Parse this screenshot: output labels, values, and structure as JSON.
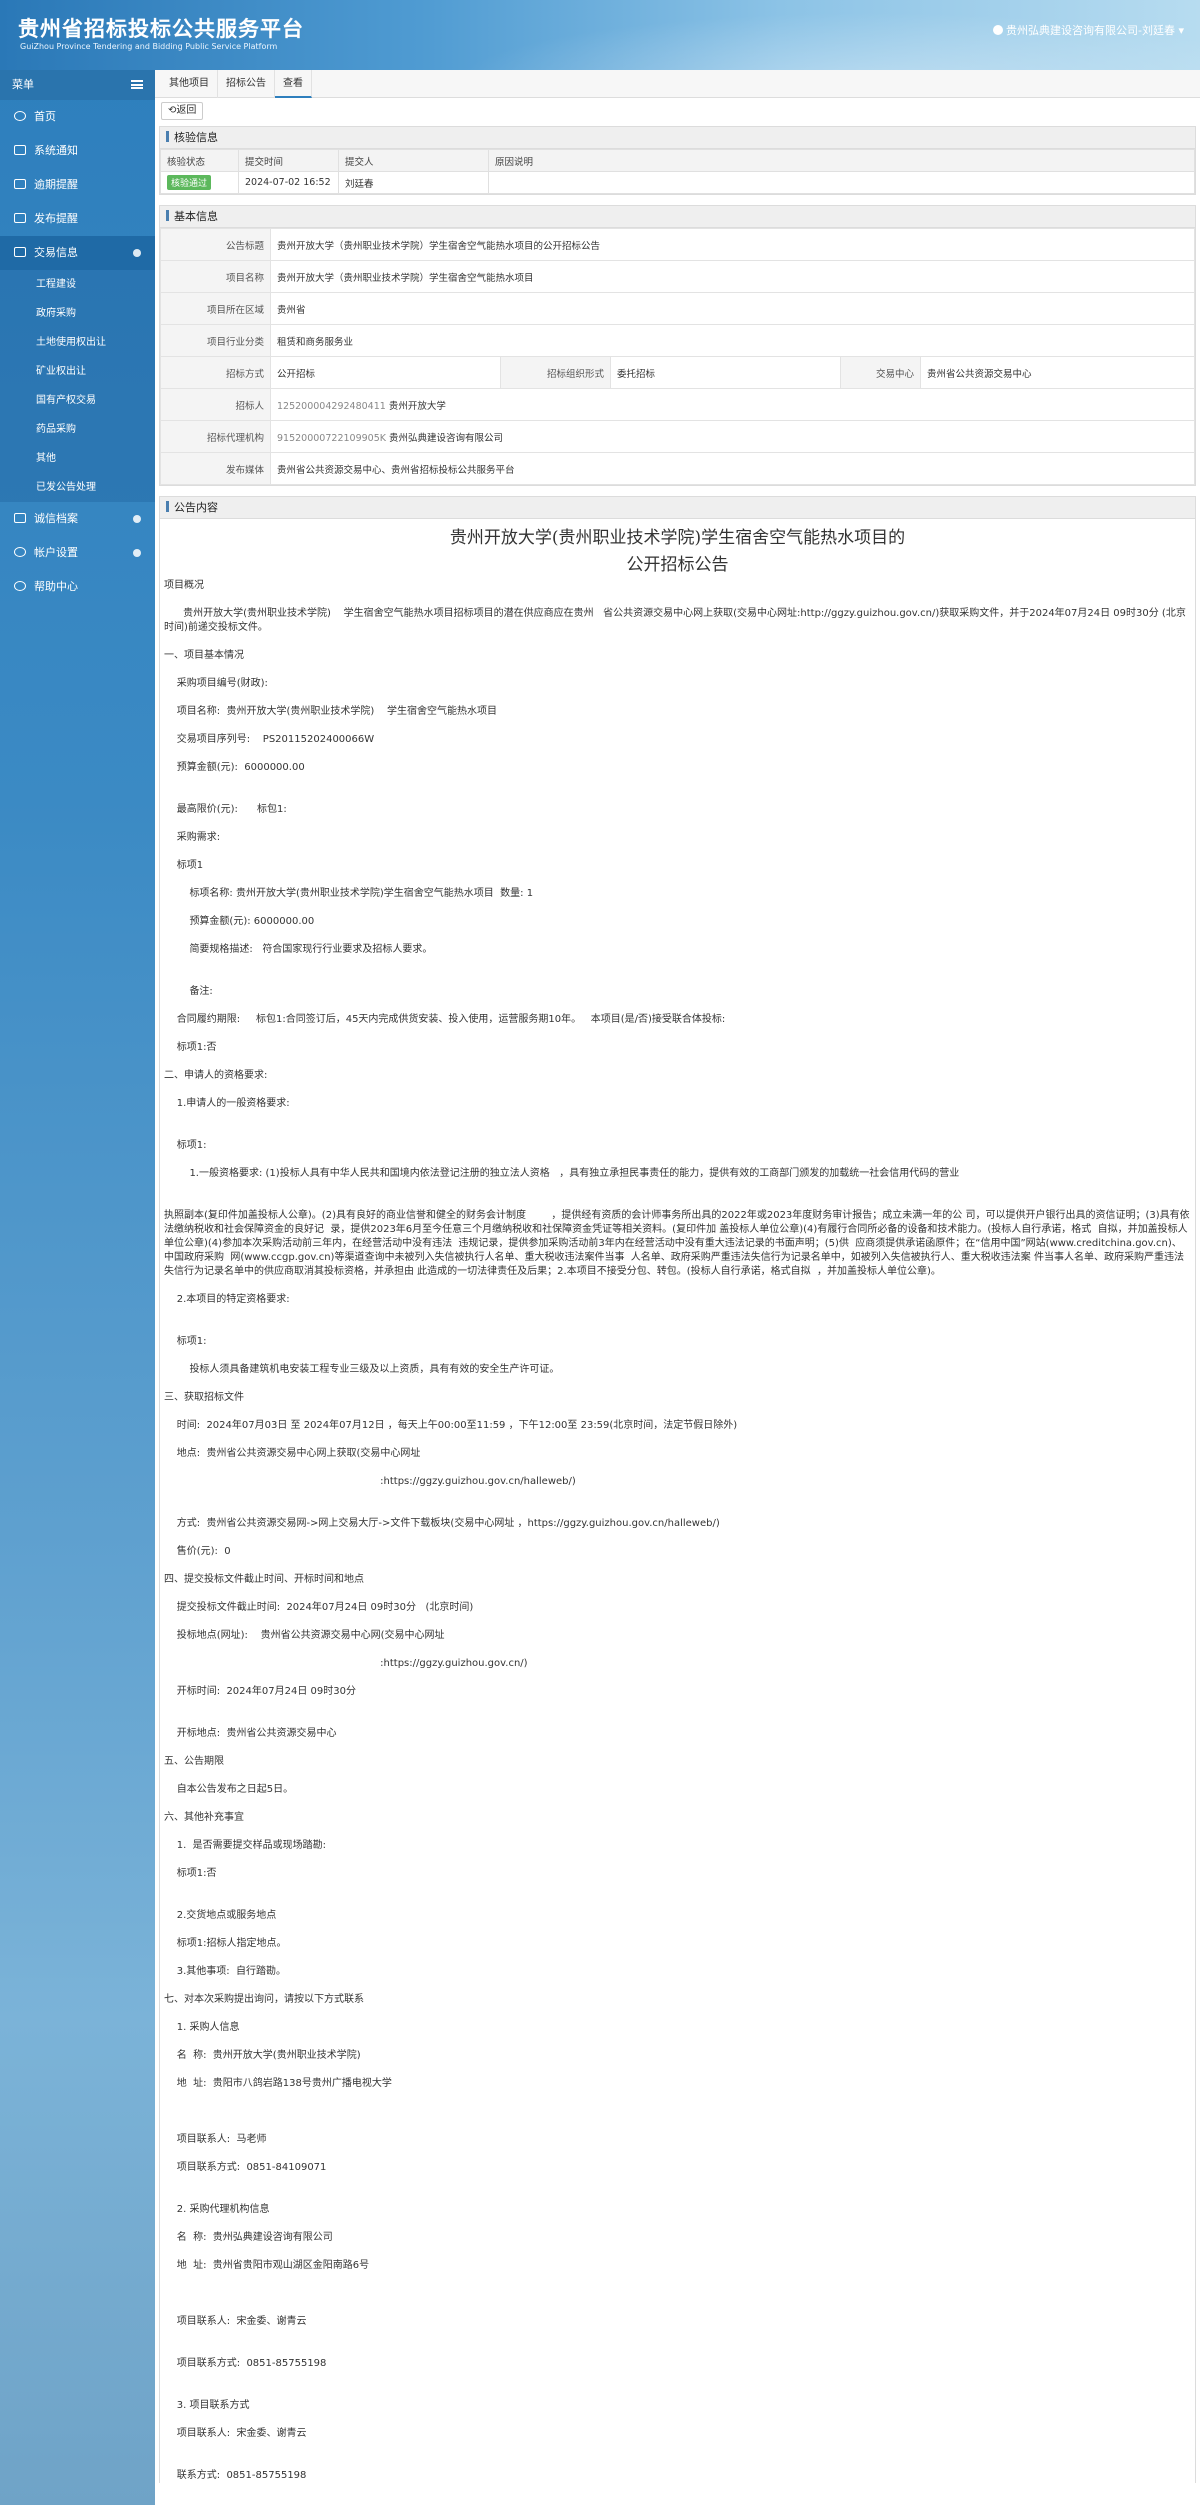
{
  "header": {
    "title": "贵州省招标投标公共服务平台",
    "subtitle": "GuiZhou Province Tendering and Bidding Public Service Platform",
    "user": "贵州弘典建设咨询有限公司-刘廷春"
  },
  "sidebar": {
    "menu_label": "菜单",
    "items": [
      {
        "label": "首页",
        "icon": "home-icon"
      },
      {
        "label": "系统通知",
        "icon": "monitor-icon"
      },
      {
        "label": "逾期提醒",
        "icon": "monitor-icon"
      },
      {
        "label": "发布提醒",
        "icon": "monitor-icon"
      },
      {
        "label": "交易信息",
        "icon": "folder-icon"
      }
    ],
    "subitems": [
      "工程建设",
      "政府采购",
      "土地使用权出让",
      "矿业权出让",
      "国有产权交易",
      "药品采购",
      "其他",
      "已发公告处理"
    ],
    "items2": [
      {
        "label": "诚信档案",
        "icon": "grid-icon"
      },
      {
        "label": "帐户设置",
        "icon": "user-icon"
      },
      {
        "label": "帮助中心",
        "icon": "help-icon"
      }
    ]
  },
  "breadcrumb": [
    "其他项目",
    "招标公告",
    "查看"
  ],
  "back_label": "返回",
  "verify": {
    "title": "核验信息",
    "headers": [
      "核验状态",
      "提交时间",
      "提交人",
      "原因说明"
    ],
    "status": "核验通过",
    "time": "2024-07-02 16:52",
    "submitter": "刘廷春",
    "reason": ""
  },
  "basic": {
    "title": "基本信息",
    "rows": [
      {
        "label": "公告标题",
        "value": "贵州开放大学（贵州职业技术学院）学生宿舍空气能热水项目的公开招标公告"
      },
      {
        "label": "项目名称",
        "value": "贵州开放大学（贵州职业技术学院）学生宿舍空气能热水项目"
      },
      {
        "label": "项目所在区域",
        "value": "贵州省"
      },
      {
        "label": "项目行业分类",
        "value": "租赁和商务服务业"
      }
    ],
    "method_label": "招标方式",
    "method": "公开招标",
    "org_label": "招标组织形式",
    "org": "委托招标",
    "center_label": "交易中心",
    "center": "贵州省公共资源交易中心",
    "rows2": [
      {
        "label": "招标人",
        "code": "125200004292480411",
        "value": "贵州开放大学"
      },
      {
        "label": "招标代理机构",
        "code": "91520000722109905K",
        "value": "贵州弘典建设咨询有限公司"
      },
      {
        "label": "发布媒体",
        "code": "",
        "value": "贵州省公共资源交易中心、贵州省招标投标公共服务平台"
      }
    ]
  },
  "content": {
    "title": "公告内容",
    "ann_title1": "贵州开放大学(贵州职业技术学院)学生宿舍空气能热水项目的",
    "ann_title2": "公开招标公告",
    "lines": [
      "项目概况",
      "      贵州开放大学(贵州职业技术学院)    学生宿舍空气能热水项目招标项目的潜在供应商应在贵州   省公共资源交易中心网上获取(交易中心网址:http://ggzy.guizhou.gov.cn/)获取采购文件，并于2024年07月24日 09时30分 (北京时间)前递交投标文件。",
      "一、项目基本情况",
      "    采购项目编号(财政):",
      "    项目名称:  贵州开放大学(贵州职业技术学院)    学生宿舍空气能热水项目",
      "    交易项目序列号:    PS20115202400066W",
      "    预算金额(元):  6000000.00",
      "",
      "    最高限价(元):      标包1:",
      "    采购需求:",
      "    标项1",
      "        标项名称: 贵州开放大学(贵州职业技术学院)学生宿舍空气能热水项目  数量: 1",
      "        预算金额(元): 6000000.00",
      "        简要规格描述:   符合国家现行行业要求及招标人要求。",
      "",
      "        备注:",
      "    合同履约期限:     标包1:合同签订后，45天内完成供货安装、投入使用，运营服务期10年。   本项目(是/否)接受联合体投标:",
      "    标项1:否",
      "二、申请人的资格要求:",
      "    1.申请人的一般资格要求:",
      "",
      "    标项1:",
      "        1.一般资格要求: (1)投标人具有中华人民共和国境内依法登记注册的独立法人资格   ，具有独立承担民事责任的能力，提供有效的工商部门颁发的加载统一社会信用代码的营业",
      "",
      "执照副本(复印件加盖投标人公章)。(2)具有良好的商业信誉和健全的财务会计制度        ，提供经有资质的会计师事务所出具的2022年或2023年度财务审计报告；成立未满一年的公 司，可以提供开户银行出具的资信证明；(3)具有依法缴纳税收和社会保障资金的良好记  录，提供2023年6月至今任意三个月缴纳税收和社保障资金凭证等相关资料。(复印件加 盖投标人单位公章)(4)有履行合同所必备的设备和技术能力。(投标人自行承诺，格式  自拟，并加盖投标人单位公章)(4)参加本次采购活动前三年内，在经营活动中没有违法  违规记录，提供参加采购活动前3年内在经营活动中没有重大违法记录的书面声明；(5)供  应商须提供承诺函原件；在“信用中国”网站(www.creditchina.gov.cn)、中国政府采购  网(www.ccgp.gov.cn)等渠道查询中未被列入失信被执行人名单、重大税收违法案件当事  人名单、政府采购严重违法失信行为记录名单中，如被列入失信被执行人、重大税收违法案 件当事人名单、政府采购严重违法失信行为记录名单中的供应商取消其投标资格，并承担由 此造成的一切法律责任及后果；2.本项目不接受分包、转包。(投标人自行承诺，格式自拟  ，并加盖投标人单位公章)。",
      "    2.本项目的特定资格要求:",
      "",
      "    标项1:",
      "        投标人须具备建筑机电安装工程专业三级及以上资质，具有有效的安全生产许可证。",
      "三、获取招标文件",
      "    时间:  2024年07月03日 至 2024年07月12日 ，每天上午00:00至11:59 ，下午12:00至 23:59(北京时间，法定节假日除外)",
      "    地点:  贵州省公共资源交易中心网上获取(交易中心网址",
      "                                                                    :https://ggzy.guizhou.gov.cn/halleweb/)",
      "",
      "    方式:  贵州省公共资源交易网->网上交易大厅->文件下载板块(交易中心网址 ，https://ggzy.guizhou.gov.cn/halleweb/)",
      "    售价(元):  0",
      "四、提交投标文件截止时间、开标时间和地点",
      "    提交投标文件截止时间:  2024年07月24日 09时30分   (北京时间)",
      "    投标地点(网址):    贵州省公共资源交易中心网(交易中心网址",
      "                                                                    :https://ggzy.guizhou.gov.cn/)",
      "    开标时间:  2024年07月24日 09时30分",
      "",
      "    开标地点:  贵州省公共资源交易中心",
      "五、公告期限",
      "    自本公告发布之日起5日。",
      "六、其他补充事宜",
      "    1.  是否需要提交样品或现场踏勘:",
      "    标项1:否",
      "",
      "    2.交货地点或服务地点",
      "    标项1:招标人指定地点。",
      "    3.其他事项:  自行踏勘。",
      "七、对本次采购提出询问，请按以下方式联系",
      "    1. 采购人信息",
      "    名  称:  贵州开放大学(贵州职业技术学院)",
      "    地  址:  贵阳市八鸽岩路138号贵州广播电视大学",
      "",
      "",
      "    项目联系人:  马老师",
      "    项目联系方式:  0851-84109071",
      "",
      "    2. 采购代理机构信息",
      "    名  称:  贵州弘典建设咨询有限公司",
      "    地  址:  贵州省贵阳市观山湖区金阳南路6号",
      "",
      "",
      "    项目联系人:  宋金委、谢青云",
      "",
      "    项目联系方式:  0851-85755198",
      "",
      "    3. 项目联系方式",
      "    项目联系人:  宋金委、谢青云",
      "",
      "    联系方式:  0851-85755198"
    ]
  }
}
